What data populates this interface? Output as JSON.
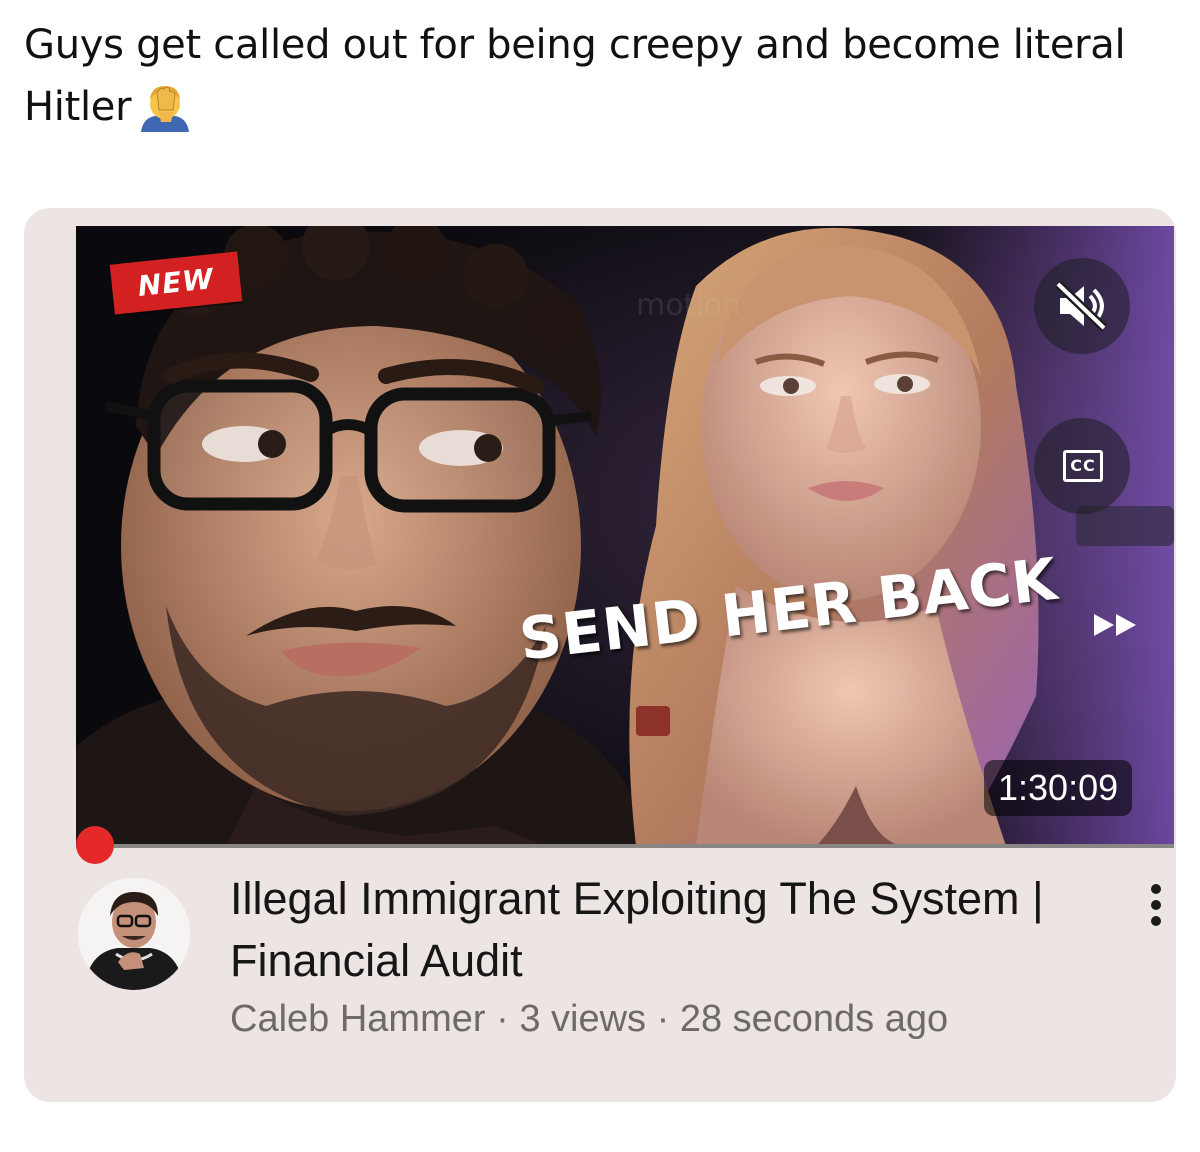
{
  "post": {
    "caption": "Guys get called out for being creepy and become literal Hitler",
    "emoji_icon": "facepalm-icon"
  },
  "video": {
    "badge": "NEW",
    "overlay_headline": "SEND HER BACK",
    "ghost_text": "motion",
    "duration": "1:30:09",
    "mute_icon": "speaker-muted-icon",
    "captions_label": "CC",
    "progress_color": "#e52828",
    "title": "Illegal Immigrant Exploiting The System | Financial Audit",
    "channel": "Caleb Hammer",
    "views": "3 views",
    "age": "28 seconds ago",
    "separator": " · ",
    "more_icon": "more-vertical-icon"
  },
  "colors": {
    "card_bg": "#ece5e3",
    "badge_red": "#d32121",
    "meta_gray": "#6d6a69"
  }
}
